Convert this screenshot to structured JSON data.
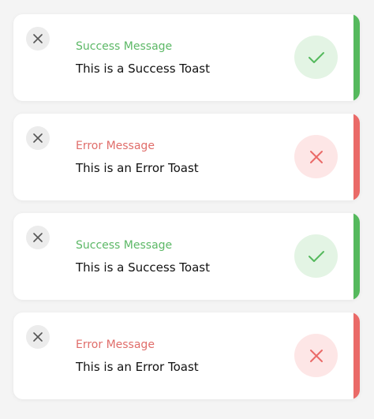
{
  "colors": {
    "success_accent": "#55b95d",
    "success_title": "#5cb866",
    "success_bg": "#e3f4e4",
    "error_accent": "#ea6a68",
    "error_title": "#e06d6a",
    "error_bg": "#fde6e6",
    "close_bg": "#ececec",
    "close_icon": "#555555"
  },
  "toasts": [
    {
      "type": "success",
      "title": "Success Message",
      "message": "This is a Success Toast",
      "close_icon": "close-icon",
      "status_icon": "check-icon"
    },
    {
      "type": "error",
      "title": "Error Message",
      "message": "This is an Error Toast",
      "close_icon": "close-icon",
      "status_icon": "x-icon"
    },
    {
      "type": "success",
      "title": "Success Message",
      "message": "This is a Success Toast",
      "close_icon": "close-icon",
      "status_icon": "check-icon"
    },
    {
      "type": "error",
      "title": "Error Message",
      "message": "This is an Error Toast",
      "close_icon": "close-icon",
      "status_icon": "x-icon"
    }
  ]
}
